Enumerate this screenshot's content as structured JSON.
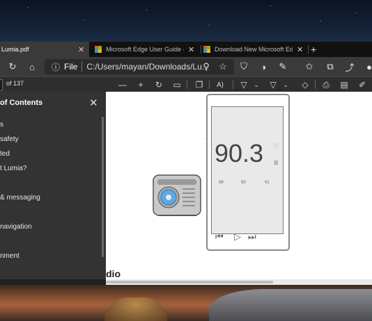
{
  "tabs": [
    {
      "title": "Lumia.pdf",
      "active": true
    },
    {
      "title": "Microsoft Edge User Guide - Ma",
      "active": false
    },
    {
      "title": "Download New Microsoft Edge |",
      "active": false
    }
  ],
  "new_tab_label": "+",
  "address": {
    "info_label": "ⓘ",
    "scheme_label": "File",
    "url": "C:/Users/mayan/Downloads/Lu..."
  },
  "pdf_toolbar": {
    "page_count": "of 137",
    "read_aloud_label": "A)"
  },
  "toc": {
    "title": "of Contents",
    "items": [
      "s",
      "safety",
      "ted",
      "t Lumia?",
      "& messaging",
      "navigation",
      "nment"
    ]
  },
  "document": {
    "frequency": "90.3",
    "ticks": [
      "89",
      "90",
      "91"
    ],
    "partial_heading": "dio"
  }
}
